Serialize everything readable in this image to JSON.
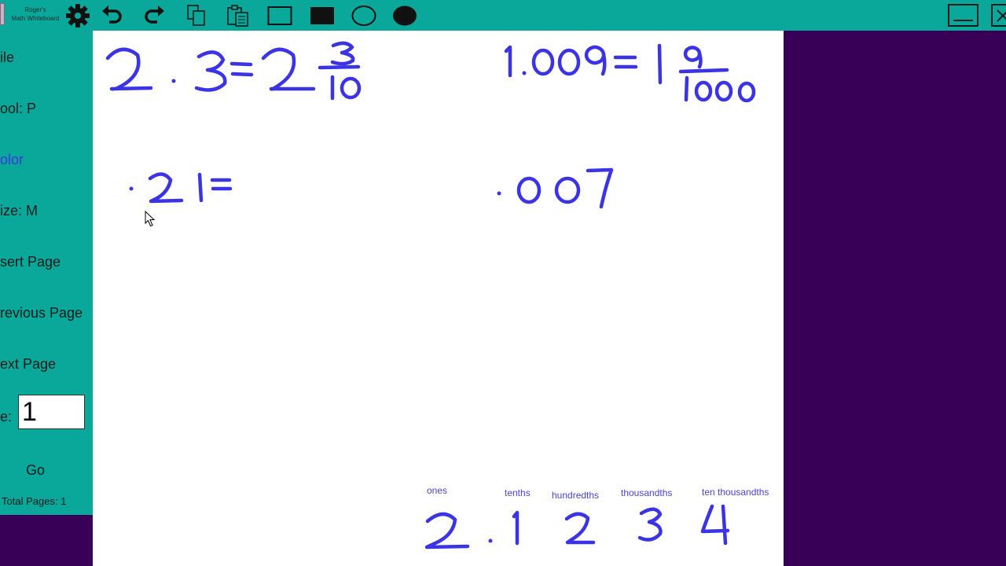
{
  "app": {
    "title_line1": "Roger's",
    "title_line2": "Math Whiteboard"
  },
  "toolbar": {
    "icons": [
      "gear-icon",
      "undo-icon",
      "redo-icon",
      "copy-icon",
      "paste-icon",
      "rectangle-outline-icon",
      "rectangle-filled-icon",
      "ellipse-outline-icon",
      "ellipse-filled-icon"
    ]
  },
  "sidebar": {
    "file": "ile",
    "tool": "ool: P",
    "color": "olor",
    "size": "ize: M",
    "insert_page": "sert Page",
    "previous_page": "revious Page",
    "next_page": "ext Page",
    "page_label": "e:",
    "page_value": "1",
    "go": "Go",
    "total_pages": "Total Pages: 1"
  },
  "colors": {
    "toolbar": "#0aa89a",
    "background": "#390057",
    "ink": "#3b33e6",
    "canvas": "#ffffff"
  },
  "whiteboard": {
    "expressions": [
      "2.3=2 3/10",
      "1.009=1 9/1000",
      ".21=",
      ".007",
      "2.1234"
    ],
    "place_values": [
      "ones",
      "tenths",
      "hundredths",
      "thousandths",
      "ten thousandths"
    ]
  }
}
